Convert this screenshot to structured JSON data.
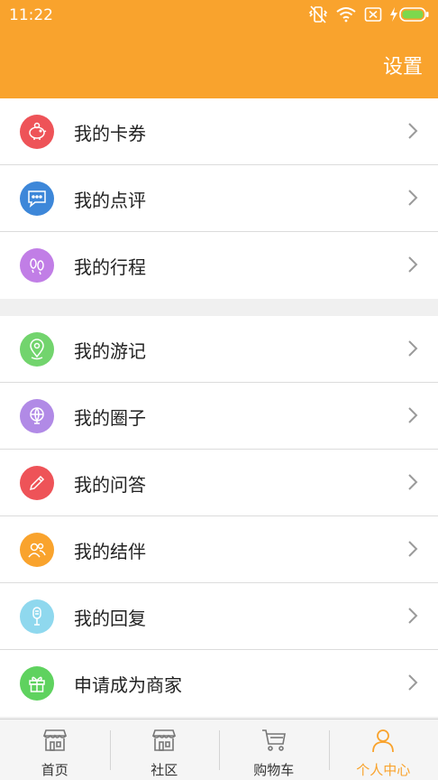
{
  "status_bar": {
    "time": "11:22"
  },
  "header": {
    "settings_label": "设置"
  },
  "colors": {
    "accent": "#f9a32d"
  },
  "menu_groups": [
    [
      {
        "label": "我的卡券",
        "icon": "piggy-bank-icon",
        "color": "#ee5358"
      },
      {
        "label": "我的点评",
        "icon": "chat-bubble-icon",
        "color": "#3d87d9"
      },
      {
        "label": "我的行程",
        "icon": "footprints-icon",
        "color": "#c17ee6"
      }
    ],
    [
      {
        "label": "我的游记",
        "icon": "location-pin-icon",
        "color": "#72d46d"
      },
      {
        "label": "我的圈子",
        "icon": "globe-icon",
        "color": "#b18ae6"
      },
      {
        "label": "我的问答",
        "icon": "pencil-icon",
        "color": "#ee5358"
      },
      {
        "label": "我的结伴",
        "icon": "people-icon",
        "color": "#f9a32d"
      },
      {
        "label": "我的回复",
        "icon": "microphone-icon",
        "color": "#8fd8ee"
      },
      {
        "label": "申请成为商家",
        "icon": "gift-icon",
        "color": "#5fd25f"
      }
    ]
  ],
  "tabs": [
    {
      "label": "首页",
      "icon": "storefront-icon",
      "active": false
    },
    {
      "label": "社区",
      "icon": "storefront-icon",
      "active": false
    },
    {
      "label": "购物车",
      "icon": "shopping-cart-icon",
      "active": false
    },
    {
      "label": "个人中心",
      "icon": "person-icon",
      "active": true
    }
  ]
}
